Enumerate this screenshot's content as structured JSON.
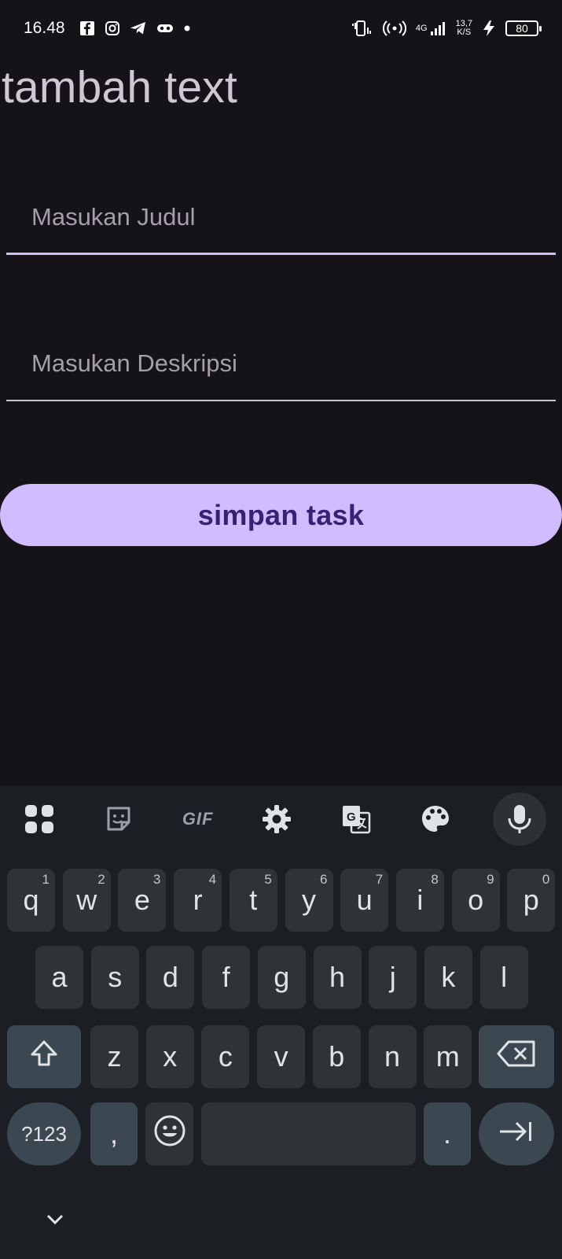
{
  "status_bar": {
    "time": "16.48",
    "left_icons": [
      "facebook-icon",
      "instagram-icon",
      "telegram-icon",
      "game-icon",
      "dot-icon"
    ],
    "network": "4G",
    "speed_value": "13,7",
    "speed_unit": "K/S",
    "battery": "80"
  },
  "page": {
    "title": "tambah text",
    "judul_placeholder": "Masukan Judul",
    "deskripsi_placeholder": "Masukan Deskripsi",
    "save_label": "simpan task"
  },
  "keyboard": {
    "toolbar": {
      "gif_label": "GIF",
      "icons": [
        "apps-grid-icon",
        "sticker-icon",
        "gif-icon",
        "settings-icon",
        "translate-icon",
        "palette-icon",
        "mic-icon"
      ]
    },
    "row1": [
      {
        "k": "q",
        "h": "1"
      },
      {
        "k": "w",
        "h": "2"
      },
      {
        "k": "e",
        "h": "3"
      },
      {
        "k": "r",
        "h": "4"
      },
      {
        "k": "t",
        "h": "5"
      },
      {
        "k": "y",
        "h": "6"
      },
      {
        "k": "u",
        "h": "7"
      },
      {
        "k": "i",
        "h": "8"
      },
      {
        "k": "o",
        "h": "9"
      },
      {
        "k": "p",
        "h": "0"
      }
    ],
    "row2": [
      "a",
      "s",
      "d",
      "f",
      "g",
      "h",
      "j",
      "k",
      "l"
    ],
    "row3": [
      "z",
      "x",
      "c",
      "v",
      "b",
      "n",
      "m"
    ],
    "sym_label": "?123",
    "comma": ",",
    "period": ".",
    "accent": "#d0bcfe"
  }
}
